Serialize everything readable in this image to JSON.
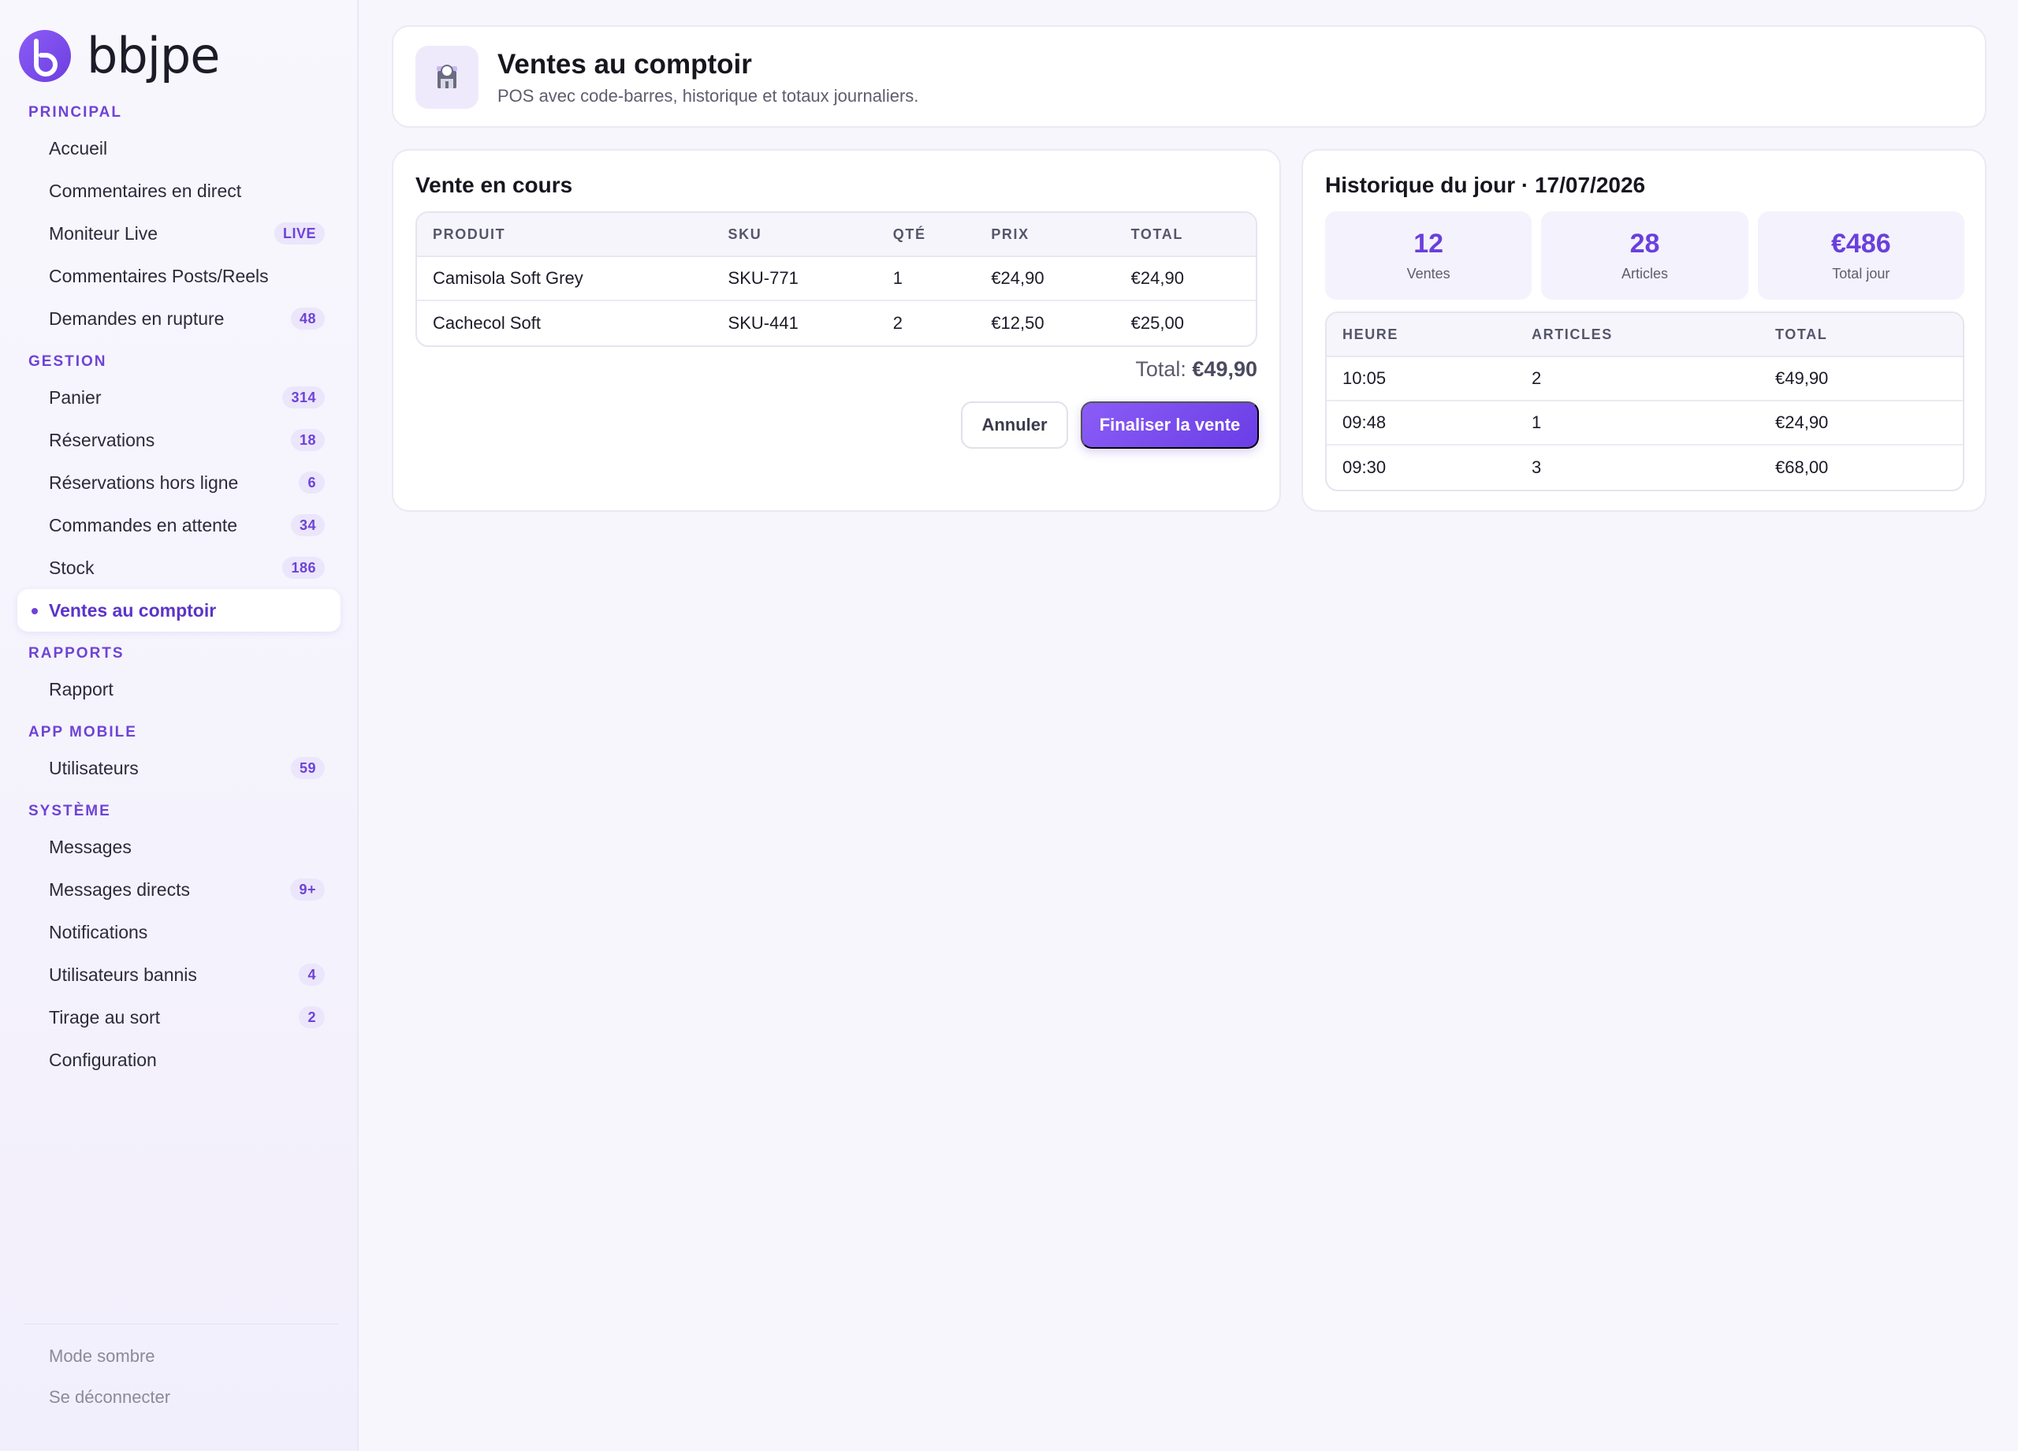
{
  "brand": {
    "name": "bbjpe"
  },
  "sidebar": {
    "sections": [
      {
        "label": "PRINCIPAL",
        "items": [
          {
            "label": "Accueil",
            "badge": ""
          },
          {
            "label": "Commentaires en direct",
            "badge": ""
          },
          {
            "label": "Moniteur Live",
            "badge": "LIVE"
          },
          {
            "label": "Commentaires Posts/Reels",
            "badge": ""
          },
          {
            "label": "Demandes en rupture",
            "badge": "48"
          }
        ]
      },
      {
        "label": "GESTION",
        "items": [
          {
            "label": "Panier",
            "badge": "314"
          },
          {
            "label": "Réservations",
            "badge": "18"
          },
          {
            "label": "Réservations hors ligne",
            "badge": "6"
          },
          {
            "label": "Commandes en attente",
            "badge": "34"
          },
          {
            "label": "Stock",
            "badge": "186"
          },
          {
            "label": "Ventes au comptoir",
            "badge": "",
            "active": true
          }
        ]
      },
      {
        "label": "RAPPORTS",
        "items": [
          {
            "label": "Rapport",
            "badge": ""
          }
        ]
      },
      {
        "label": "APP MOBILE",
        "items": [
          {
            "label": "Utilisateurs",
            "badge": "59"
          }
        ]
      },
      {
        "label": "SYSTÈME",
        "items": [
          {
            "label": "Messages",
            "badge": ""
          },
          {
            "label": "Messages directs",
            "badge": "9+"
          },
          {
            "label": "Notifications",
            "badge": ""
          },
          {
            "label": "Utilisateurs bannis",
            "badge": "4"
          },
          {
            "label": "Tirage au sort",
            "badge": "2"
          },
          {
            "label": "Configuration",
            "badge": ""
          }
        ]
      }
    ],
    "footer": {
      "dark_mode": "Mode sombre",
      "logout": "Se déconnecter"
    }
  },
  "header": {
    "icon": "store-icon",
    "title": "Ventes au comptoir",
    "subtitle": "POS avec code-barres, historique et totaux journaliers."
  },
  "current_sale": {
    "title": "Vente en cours",
    "columns": [
      "PRODUIT",
      "SKU",
      "QTÉ",
      "PRIX",
      "TOTAL"
    ],
    "rows": [
      [
        "Camisola Soft Grey",
        "SKU-771",
        "1",
        "€24,90",
        "€24,90"
      ],
      [
        "Cachecol Soft",
        "SKU-441",
        "2",
        "€12,50",
        "€25,00"
      ]
    ],
    "total_label": "Total:",
    "total_value": "€49,90",
    "cancel_label": "Annuler",
    "finalize_label": "Finaliser la vente"
  },
  "history": {
    "title": "Historique du jour · 17/07/2026",
    "stats": [
      {
        "value": "12",
        "label": "Ventes"
      },
      {
        "value": "28",
        "label": "Articles"
      },
      {
        "value": "€486",
        "label": "Total jour"
      }
    ],
    "columns": [
      "HEURE",
      "ARTICLES",
      "TOTAL"
    ],
    "rows": [
      [
        "10:05",
        "2",
        "€49,90"
      ],
      [
        "09:48",
        "1",
        "€24,90"
      ],
      [
        "09:30",
        "3",
        "€68,00"
      ]
    ]
  },
  "colors": {
    "accent": "#6e43d6",
    "accent_gradient_start": "#8b5cf6",
    "accent_gradient_end": "#6a3ee6",
    "background": "#f6f6fc"
  }
}
